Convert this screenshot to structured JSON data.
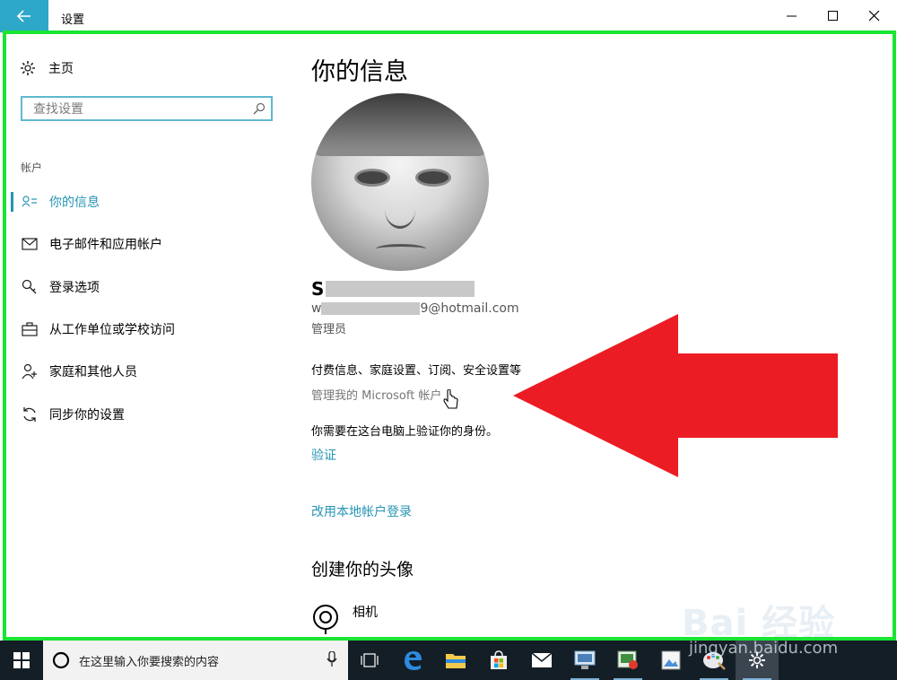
{
  "window": {
    "title": "设置"
  },
  "sidebar": {
    "home_label": "主页",
    "search_placeholder": "查找设置",
    "section_label": "帐户",
    "items": [
      {
        "label": "你的信息",
        "icon": "person-icon",
        "selected": true
      },
      {
        "label": "电子邮件和应用帐户",
        "icon": "mail-icon",
        "selected": false
      },
      {
        "label": "登录选项",
        "icon": "key-icon",
        "selected": false
      },
      {
        "label": "从工作单位或学校访问",
        "icon": "briefcase-icon",
        "selected": false
      },
      {
        "label": "家庭和其他人员",
        "icon": "add-person-icon",
        "selected": false
      },
      {
        "label": "同步你的设置",
        "icon": "sync-icon",
        "selected": false
      }
    ]
  },
  "main": {
    "page_title": "你的信息",
    "user_name_initial": "S",
    "email_prefix": "w",
    "email_suffix": "9@hotmail.com",
    "role": "管理员",
    "info_line": "付费信息、家庭设置、订阅、安全设置等",
    "manage_link": "管理我的 Microsoft 帐户",
    "verify_text": "你需要在这台电脑上验证你的身份。",
    "verify_link": "验证",
    "local_account_link": "改用本地帐户登录",
    "create_avatar_heading": "创建你的头像",
    "camera_label": "相机"
  },
  "taskbar": {
    "search_placeholder": "在这里输入你要搜索的内容",
    "icons": [
      "task-view-icon",
      "edge-icon",
      "file-explorer-icon",
      "store-icon",
      "mail-icon",
      "remote-desktop-icon",
      "media-app-icon",
      "photo-app-icon",
      "paint-icon",
      "settings-icon"
    ]
  },
  "watermark": {
    "main": "Bai 经验",
    "sub": "jingyan.baidu.com"
  },
  "colors": {
    "accent": "#2694b3",
    "highlight_border": "#19e533",
    "arrow": "#ec1c24",
    "taskbar": "#141e26"
  }
}
